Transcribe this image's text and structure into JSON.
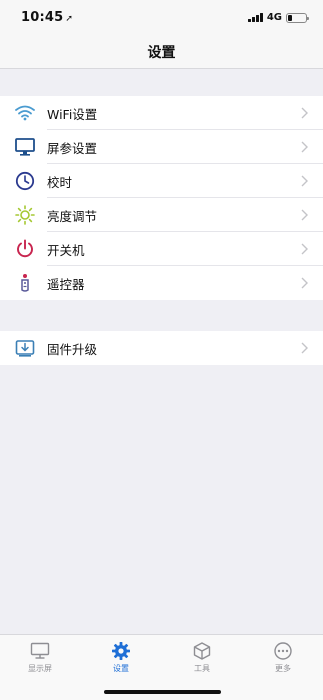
{
  "status_bar": {
    "time": "10:45",
    "location_glyph": "➚",
    "network": "4G"
  },
  "nav": {
    "title": "设置"
  },
  "settings_group_1": [
    {
      "label": "WiFi设置",
      "icon": "wifi-icon",
      "color": "#4a90c8"
    },
    {
      "label": "屏参设置",
      "icon": "monitor-icon",
      "color": "#1e4f8c"
    },
    {
      "label": "校时",
      "icon": "clock-icon",
      "color": "#2b3a8f"
    },
    {
      "label": "亮度调节",
      "icon": "brightness-icon",
      "color": "#a5c832"
    },
    {
      "label": "开关机",
      "icon": "power-icon",
      "color": "#c8254f"
    },
    {
      "label": "遥控器",
      "icon": "remote-icon",
      "color": "#5a5a9a"
    }
  ],
  "settings_group_2": [
    {
      "label": "固件升级",
      "icon": "firmware-icon",
      "color": "#3a7fb5"
    }
  ],
  "tab_bar": {
    "tabs": [
      {
        "label": "显示屏",
        "icon": "display-tab-icon",
        "active": false
      },
      {
        "label": "设置",
        "icon": "settings-gear-icon",
        "active": true
      },
      {
        "label": "工具",
        "icon": "toolbox-icon",
        "active": false
      },
      {
        "label": "更多",
        "icon": "more-icon",
        "active": false
      }
    ],
    "active_color": "#1f6fd6",
    "inactive_color": "#8e8e93"
  }
}
